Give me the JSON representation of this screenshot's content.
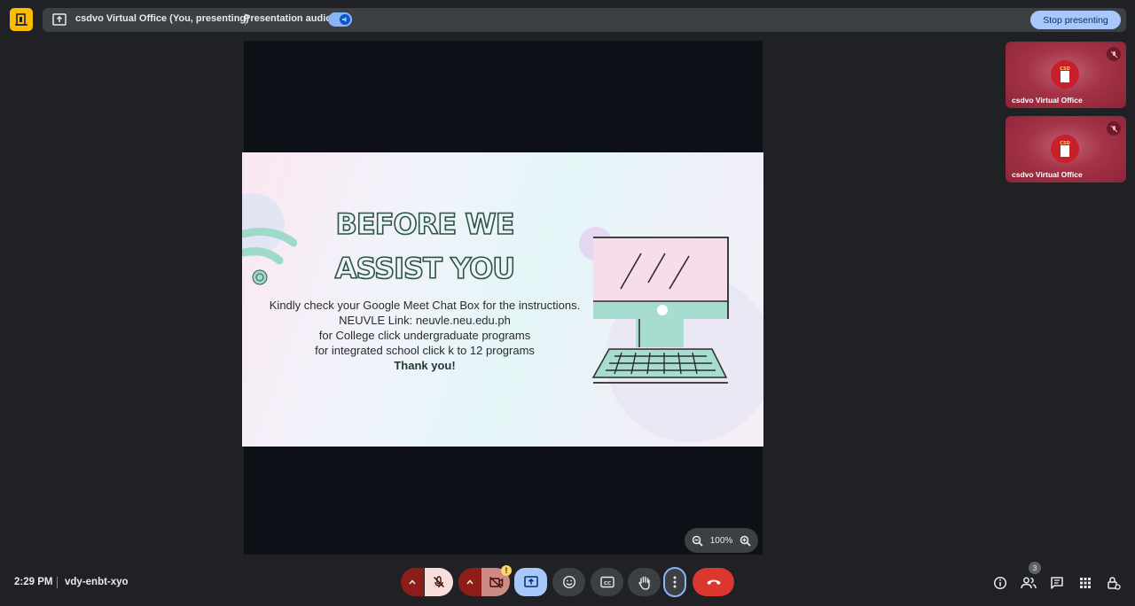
{
  "colors": {
    "background": "#202124",
    "bar": "#3c4043",
    "accent": "#a8c7fa",
    "end_call": "#dc362e",
    "tile": "#a43347"
  },
  "top_bar": {
    "app_icon": "door-icon",
    "presenting_icon": "present-to-all-icon",
    "title": "csdvo Virtual Office (You, presenting)",
    "audio_label": "Presentation audio",
    "audio_toggle_on": true,
    "stop_label": "Stop presenting"
  },
  "slide": {
    "title_line1": "BEFORE WE",
    "title_line2": "ASSIST YOU",
    "lines": [
      "Kindly check your Google Meet Chat Box for the instructions.",
      "NEUVLE Link: neuvle.neu.edu.ph",
      "for College click undergraduate programs",
      "for integrated school click k to 12 programs"
    ],
    "thanks": "Thank you!",
    "illustrations": [
      "wifi-icon",
      "desktop-computer-icon"
    ]
  },
  "zoom": {
    "level": "100%"
  },
  "tiles": [
    {
      "name": "csdvo Virtual Office",
      "muted": true,
      "avatar_text": "CSD"
    },
    {
      "name": "csdvo Virtual Office",
      "muted": true,
      "avatar_text": "CSD"
    }
  ],
  "bottom_bar": {
    "time": "2:29 PM",
    "meeting_code": "vdy-enbt-xyo",
    "warning_badge": "!",
    "people_count": "3",
    "controls": [
      "mic-off-icon",
      "camera-off-icon",
      "present-icon",
      "emoji-icon",
      "captions-icon",
      "raise-hand-icon",
      "more-options-icon",
      "end-call-icon"
    ],
    "right_icons": [
      "info-icon",
      "people-icon",
      "chat-icon",
      "activities-icon",
      "host-controls-icon"
    ]
  }
}
